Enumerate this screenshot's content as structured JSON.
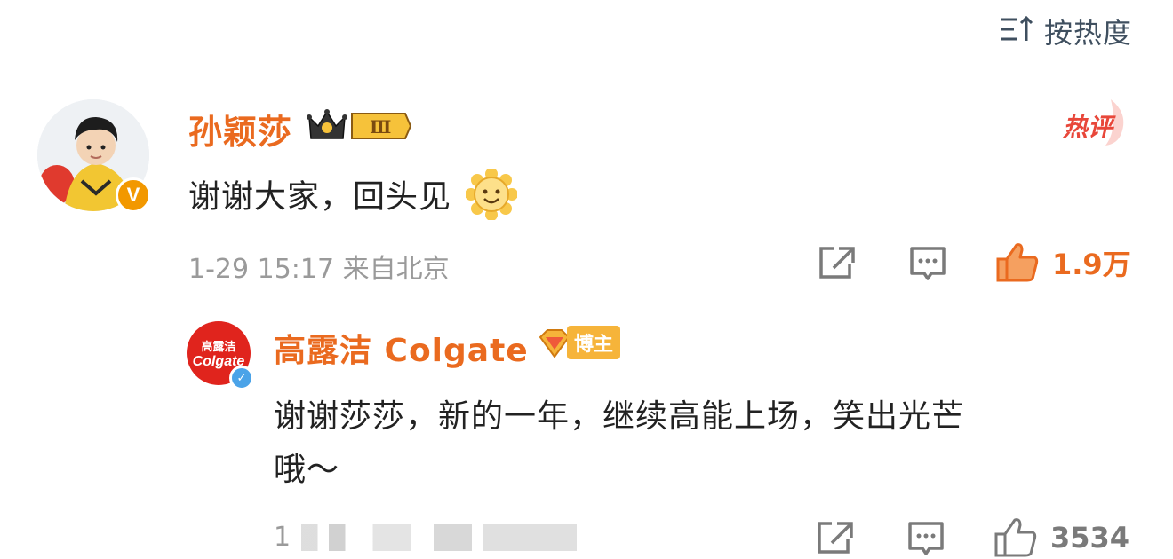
{
  "sort": {
    "label": "按热度"
  },
  "comments": [
    {
      "user": "孙颖莎",
      "rank_badge": "Ⅲ",
      "hot_tag": "热评",
      "text": "谢谢大家，回头见",
      "time_location": "1-29 15:17 来自北京",
      "likes": "1.9万",
      "colors": {
        "name": "#ea6a1f",
        "like": "#ea6a1f",
        "hot": "#e8473a",
        "verified": "#f29800"
      }
    }
  ],
  "reply": {
    "user": "高露洁 Colgate",
    "badge": "博主",
    "avatar_brand_cn": "高露洁",
    "avatar_brand_en": "Colgate",
    "text_line1": "谢谢莎莎，新的一年，继续高能上场，笑出光芒",
    "text_line2": "哦～",
    "time_location": "1",
    "likes": "3534",
    "colors": {
      "brand": "#e0241d",
      "verified": "#4ba3e8"
    }
  }
}
